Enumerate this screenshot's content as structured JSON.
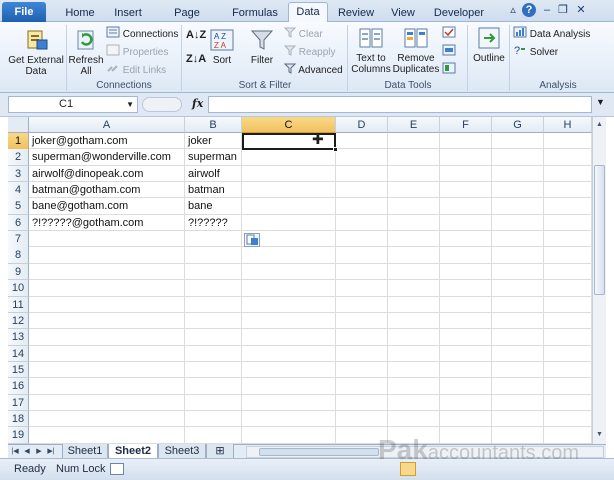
{
  "tabs": {
    "file": "File",
    "items": [
      "Home",
      "Insert",
      "Page Layout",
      "Formulas",
      "Data",
      "Review",
      "View",
      "Developer"
    ],
    "active": "Data"
  },
  "ribbon": {
    "get_external_data": "Get External Data",
    "refresh_all": "Refresh All",
    "connections": "Connections",
    "properties": "Properties",
    "edit_links": "Edit Links",
    "sort_filter": {
      "sort": "Sort",
      "filter": "Filter",
      "clear": "Clear",
      "reapply": "Reapply",
      "advanced": "Advanced"
    },
    "data_tools": {
      "text_to_columns": "Text to Columns",
      "remove_duplicates": "Remove Duplicates"
    },
    "outline": "Outline",
    "analysis": {
      "data_analysis": "Data Analysis",
      "solver": "Solver"
    },
    "groups": {
      "connections": "Connections",
      "sort_filter": "Sort & Filter",
      "data_tools": "Data Tools",
      "analysis": "Analysis"
    }
  },
  "formula_bar": {
    "name_box": "C1",
    "fx": "fx",
    "formula": ""
  },
  "grid": {
    "columns": [
      "A",
      "B",
      "C",
      "D",
      "E",
      "F",
      "G",
      "H"
    ],
    "selected_column": "C",
    "rows": [
      "1",
      "2",
      "3",
      "4",
      "5",
      "6",
      "7",
      "8",
      "9",
      "10",
      "11",
      "12",
      "13",
      "14",
      "15",
      "16",
      "17",
      "18",
      "19"
    ],
    "data": [
      [
        "joker@gotham.com",
        "joker"
      ],
      [
        "superman@wonderville.com",
        "superman"
      ],
      [
        "airwolf@dinopeak.com",
        "airwolf"
      ],
      [
        "batman@gotham.com",
        "batman"
      ],
      [
        "bane@gotham.com",
        "bane"
      ],
      [
        "?!?????@gotham.com",
        "?!?????"
      ]
    ]
  },
  "sheets": {
    "tabs": [
      "Sheet1",
      "Sheet2",
      "Sheet3"
    ],
    "active": "Sheet2"
  },
  "status": {
    "ready": "Ready",
    "num_lock": "Num Lock"
  },
  "watermark": {
    "brand": "Pak",
    "suffix": "accountants.com"
  },
  "colors": {
    "accent": "#1f5fb0",
    "selected_header": "#f1c15f"
  }
}
